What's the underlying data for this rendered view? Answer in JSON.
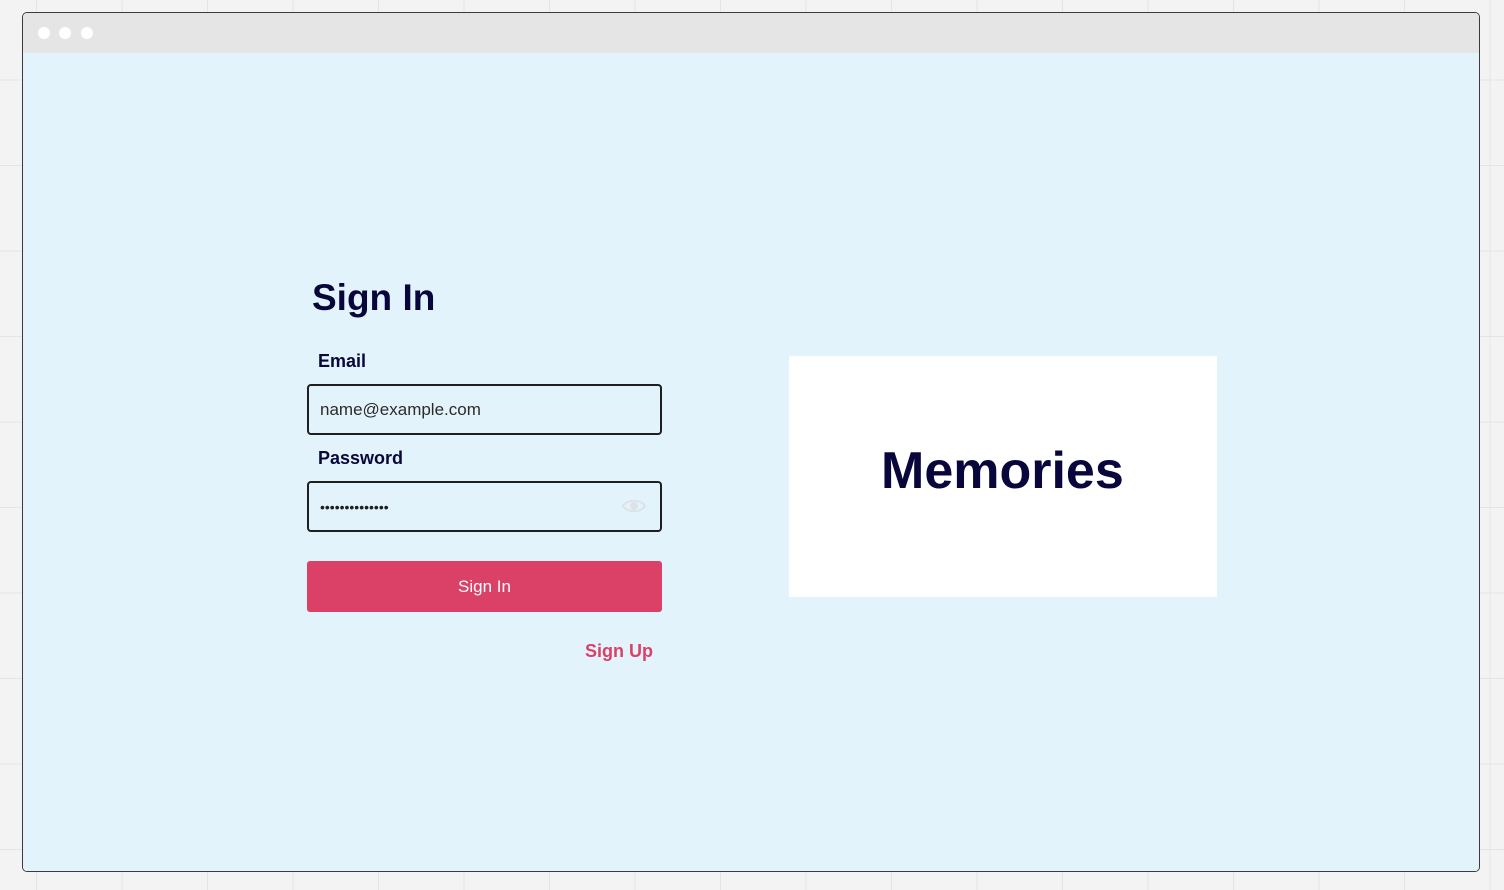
{
  "signin": {
    "heading": "Sign In",
    "email_label": "Email",
    "email_value": "name@example.com",
    "password_label": "Password",
    "password_value": "••••••••••••••",
    "submit_label": "Sign In",
    "signup_link": "Sign Up"
  },
  "brand": {
    "title": "Memories"
  },
  "icons": {
    "password_toggle": "eye-icon"
  },
  "colors": {
    "page_background": "#e3f3fc",
    "accent": "#db4066",
    "heading_text": "#08063a",
    "window_titlebar": "#e5e5e5"
  }
}
